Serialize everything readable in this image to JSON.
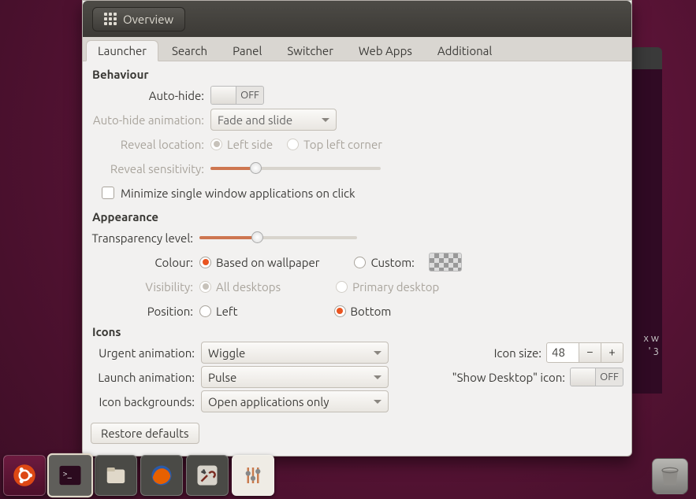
{
  "window": {
    "overview_label": "Overview",
    "tabs": [
      "Launcher",
      "Search",
      "Panel",
      "Switcher",
      "Web Apps",
      "Additional"
    ],
    "active_tab": 0,
    "restore_label": "Restore defaults"
  },
  "behaviour": {
    "heading": "Behaviour",
    "auto_hide_label": "Auto-hide:",
    "auto_hide_state": "OFF",
    "auto_hide_anim_label": "Auto-hide animation:",
    "auto_hide_anim_value": "Fade and slide",
    "reveal_loc_label": "Reveal location:",
    "reveal_loc_opts": [
      "Left side",
      "Top left corner"
    ],
    "reveal_sens_label": "Reveal sensitivity:",
    "minimize_label": "Minimize single window applications on click"
  },
  "appearance": {
    "heading": "Appearance",
    "transparency_label": "Transparency level:",
    "colour_label": "Colour:",
    "colour_opts": [
      "Based on wallpaper",
      "Custom:"
    ],
    "visibility_label": "Visibility:",
    "visibility_opts": [
      "All desktops",
      "Primary desktop"
    ],
    "position_label": "Position:",
    "position_opts": [
      "Left",
      "Bottom"
    ]
  },
  "icons": {
    "heading": "Icons",
    "urgent_label": "Urgent animation:",
    "urgent_value": "Wiggle",
    "launch_label": "Launch animation:",
    "launch_value": "Pulse",
    "bg_label": "Icon backgrounds:",
    "bg_value": "Open applications only",
    "size_label": "Icon size:",
    "size_value": "48",
    "showdesk_label": "\"Show Desktop\" icon:",
    "showdesk_state": "OFF"
  },
  "terminal": {
    "lines": [
      "x  w",
      "' 3"
    ]
  },
  "launcher_icons": [
    "ubuntu",
    "terminal",
    "files",
    "firefox",
    "tweaks",
    "unity-tweak"
  ],
  "colors": {
    "accent": "#e95420",
    "win_bg": "#f2f1f0",
    "desktop": "#5d1438"
  }
}
